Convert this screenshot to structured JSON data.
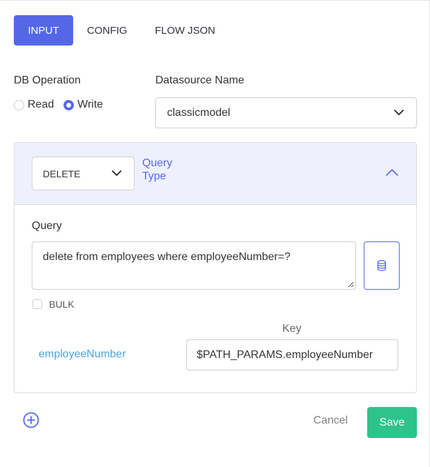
{
  "tabs": [
    {
      "label": "INPUT",
      "active": true
    },
    {
      "label": "CONFIG",
      "active": false
    },
    {
      "label": "FLOW JSON",
      "active": false
    }
  ],
  "db_operation": {
    "label": "DB Operation",
    "options": [
      {
        "label": "Read",
        "checked": false
      },
      {
        "label": "Write",
        "checked": true
      }
    ]
  },
  "datasource": {
    "label": "Datasource Name",
    "value": "classicmodel"
  },
  "query_section": {
    "query_type_value": "DELETE",
    "query_type_label_line1": "Query",
    "query_type_label_line2": "Type",
    "query_label": "Query",
    "query_text": "delete from employees where employeeNumber=?",
    "bulk_label": "BULK",
    "bulk_checked": false,
    "key_header": "Key",
    "params": [
      {
        "name": "employeeNumber",
        "value": "$PATH_PARAMS.employeeNumber"
      }
    ]
  },
  "footer": {
    "cancel_label": "Cancel",
    "save_label": "Save"
  },
  "colors": {
    "accent": "#5468e7",
    "save": "#2ec38b",
    "param_name": "#4aa3df",
    "card_header_bg": "#eef0fd"
  }
}
